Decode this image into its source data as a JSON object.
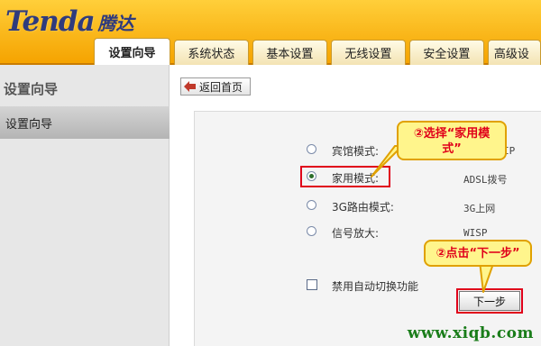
{
  "brand": {
    "name_en": "Tenda",
    "name_cn": "腾达"
  },
  "tabs": [
    {
      "label": "设置向导",
      "active": true
    },
    {
      "label": "系统状态",
      "active": false
    },
    {
      "label": "基本设置",
      "active": false
    },
    {
      "label": "无线设置",
      "active": false
    },
    {
      "label": "安全设置",
      "active": false
    },
    {
      "label": "高级设",
      "active": false
    }
  ],
  "sidebar": {
    "title": "设置向导",
    "items": [
      {
        "label": "设置向导"
      }
    ]
  },
  "toolbar": {
    "home_label": "返回首页"
  },
  "options": [
    {
      "label": "宾馆模式:",
      "value": "IP",
      "checked": false
    },
    {
      "label": "家用模式:",
      "value": "ADSL拨号",
      "checked": true
    },
    {
      "label": "3G路由模式:",
      "value": "3G上网",
      "checked": false
    },
    {
      "label": "信号放大:",
      "value": "WISP",
      "checked": false
    }
  ],
  "auto_switch": {
    "label": "禁用自动切换功能",
    "checked": false
  },
  "next_button": {
    "label": "下一步"
  },
  "callouts": {
    "select_home": {
      "line1": "②选择“家用模",
      "line2": "式”"
    },
    "click_next": {
      "text": "②点击“下一步”"
    }
  },
  "watermark": "www.xiqb.com",
  "colors": {
    "header": "#f5a300",
    "highlight": "#e0001a",
    "callout_bg": "#fff58c"
  }
}
